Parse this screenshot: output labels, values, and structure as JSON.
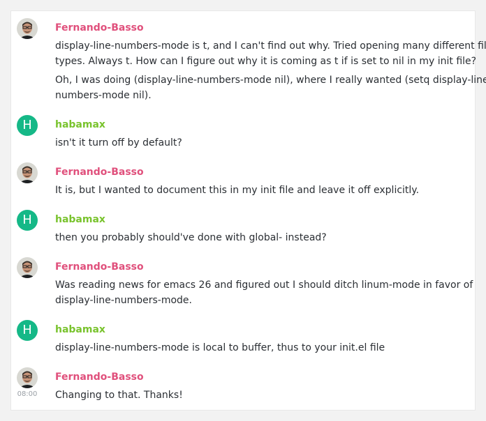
{
  "colors": {
    "fernando": "#e0507c",
    "habamax": "#79c32d",
    "habamax_avatar": "#15b887"
  },
  "messages": [
    {
      "user": "Fernando-Basso",
      "avatar": "photo",
      "text": [
        "display-line-numbers-mode is t, and I can't find out why. Tried opening many different file",
        "types. Always t. How can I figure out why it is coming as t if is set to nil in my init file?",
        "Oh, I was doing (display-line-numbers-mode nil), where I really wanted (setq display-line-",
        "numbers-mode nil)."
      ]
    },
    {
      "user": "habamax",
      "avatar": "H",
      "text": [
        "isn't it turn off by default?"
      ]
    },
    {
      "user": "Fernando-Basso",
      "avatar": "photo",
      "text": [
        "It is, but I wanted to document this in my init file and leave it off explicitly."
      ]
    },
    {
      "user": "habamax",
      "avatar": "H",
      "text": [
        "then you probably should've done with global- instead?"
      ]
    },
    {
      "user": "Fernando-Basso",
      "avatar": "photo",
      "text": [
        "Was reading news for emacs 26 and figured out I should ditch linum-mode in favor of",
        "display-line-numbers-mode."
      ]
    },
    {
      "user": "habamax",
      "avatar": "H",
      "text": [
        "display-line-numbers-mode is local to buffer, thus to your init.el file"
      ]
    },
    {
      "user": "Fernando-Basso",
      "avatar": "photo",
      "time": "08:00",
      "text": [
        "Changing to that. Thanks!"
      ]
    }
  ]
}
